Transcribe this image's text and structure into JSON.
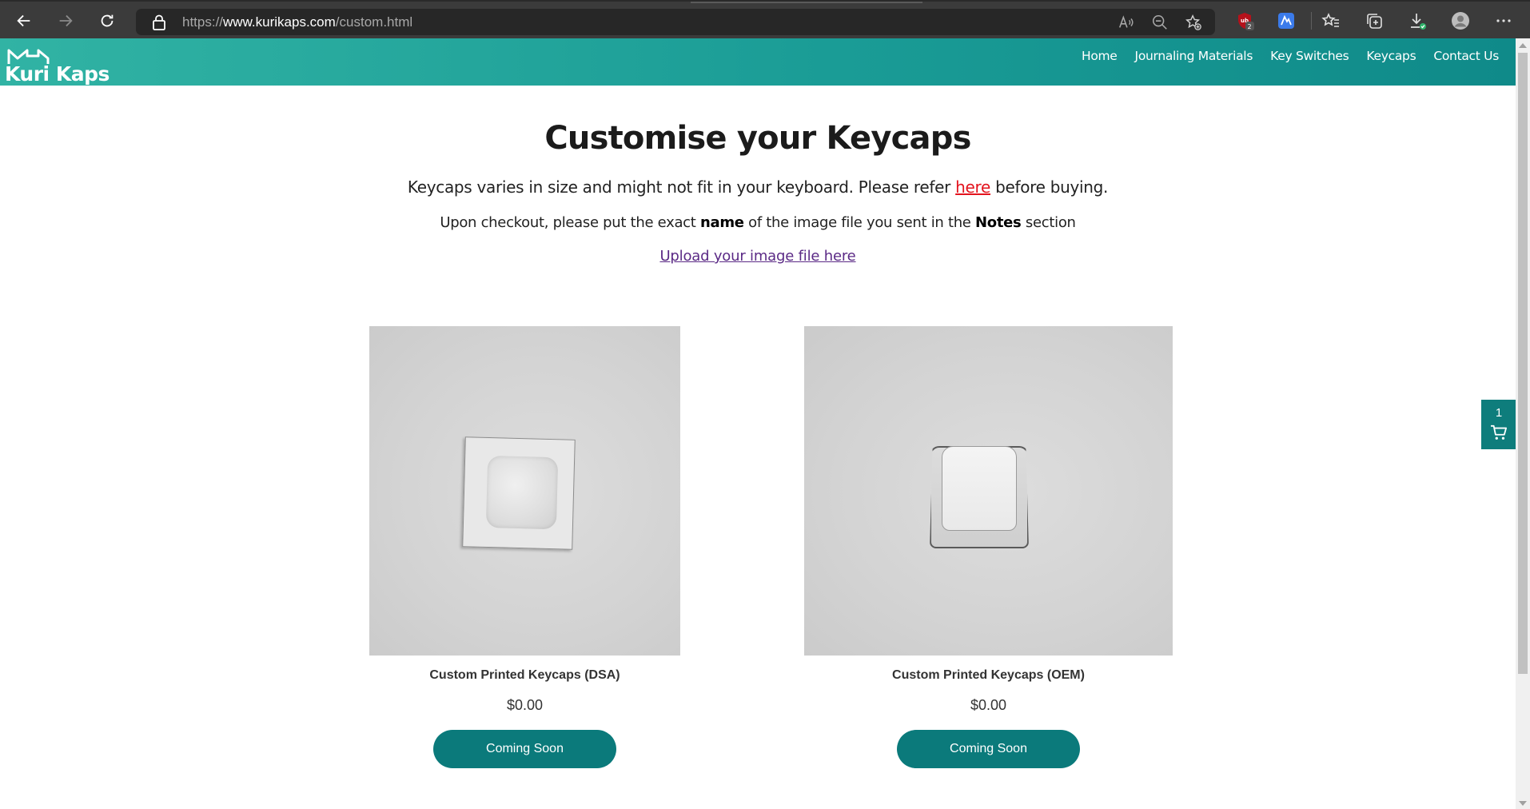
{
  "browser": {
    "url_prefix": "https://",
    "url_host": "www.kurikaps.com",
    "url_path": "/custom.html",
    "extension_badge": "2"
  },
  "site": {
    "logo_text": "Kuri Kaps",
    "nav": [
      {
        "label": "Home"
      },
      {
        "label": "Journaling Materials"
      },
      {
        "label": "Key Switches"
      },
      {
        "label": "Keycaps"
      },
      {
        "label": "Contact Us"
      }
    ],
    "colors": {
      "header_start": "#31b3a4",
      "header_end": "#0f8a89",
      "button": "#0b7a7b",
      "link_red": "#e3141e",
      "link_visited": "#5b2a86"
    }
  },
  "content": {
    "title": "Customise your Keycaps",
    "line1_before": "Keycaps varies in size and might not fit in your keyboard. Please refer ",
    "line1_link": "here",
    "line1_after": " before buying.",
    "line2_a": "Upon checkout, please put the exact ",
    "line2_b": "name",
    "line2_c": " of the image file you sent in the ",
    "line2_d": "Notes",
    "line2_e": " section",
    "upload_link": "Upload your image file here"
  },
  "products": [
    {
      "name": "Custom Printed Keycaps (DSA)",
      "price": "$0.00",
      "button": "Coming Soon",
      "image_icon": "dsa-keycap-photo"
    },
    {
      "name": "Custom Printed Keycaps (OEM)",
      "price": "$0.00",
      "button": "Coming Soon",
      "image_icon": "oem-keycap-photo"
    }
  ],
  "cart": {
    "count": "1",
    "icon": "cart-icon"
  }
}
